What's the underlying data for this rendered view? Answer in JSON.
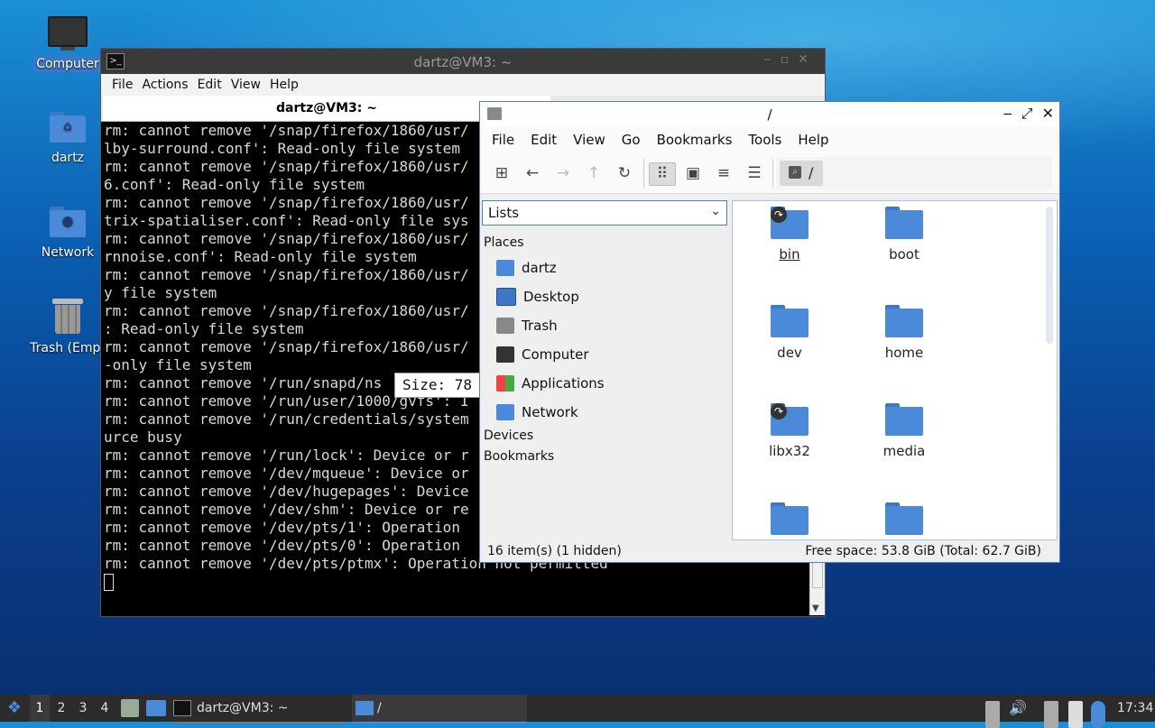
{
  "desktop": {
    "icons": [
      {
        "label": "Computer"
      },
      {
        "label": "dartz"
      },
      {
        "label": "Network"
      },
      {
        "label": "Trash (Empt"
      }
    ]
  },
  "terminal": {
    "title": "dartz@VM3: ~",
    "menu": [
      "File",
      "Actions",
      "Edit",
      "View",
      "Help"
    ],
    "tab_label": "dartz@VM3: ~",
    "lines": [
      "rm: cannot remove '/snap/firefox/1860/usr/",
      "lby-surround.conf': Read-only file system",
      "rm: cannot remove '/snap/firefox/1860/usr/",
      "6.conf': Read-only file system",
      "rm: cannot remove '/snap/firefox/1860/usr/",
      "trix-spatialiser.conf': Read-only file sys",
      "rm: cannot remove '/snap/firefox/1860/usr/",
      "rnnoise.conf': Read-only file system",
      "rm: cannot remove '/snap/firefox/1860/usr/",
      "y file system",
      "rm: cannot remove '/snap/firefox/1860/usr/",
      ": Read-only file system",
      "rm: cannot remove '/snap/firefox/1860/usr/",
      "-only file system",
      "rm: cannot remove '/run/snapd/ns",
      "rm: cannot remove '/run/user/1000/gvfs': I",
      "rm: cannot remove '/run/credentials/system",
      "urce busy",
      "rm: cannot remove '/run/lock': Device or r",
      "rm: cannot remove '/dev/mqueue': Device or",
      "rm: cannot remove '/dev/hugepages': Device",
      "rm: cannot remove '/dev/shm': Device or re",
      "rm: cannot remove '/dev/pts/1': Operation",
      "rm: cannot remove '/dev/pts/0': Operation",
      "rm: cannot remove '/dev/pts/ptmx': Operation not permitted"
    ],
    "tooltip": "Size: 78"
  },
  "filemanager": {
    "title": "/",
    "menu": [
      "File",
      "Edit",
      "View",
      "Go",
      "Bookmarks",
      "Tools",
      "Help"
    ],
    "path": "/",
    "side_mode": "Lists",
    "places_header": "Places",
    "places": [
      "dartz",
      "Desktop",
      "Trash",
      "Computer",
      "Applications",
      "Network"
    ],
    "devices_header": "Devices",
    "bookmarks_header": "Bookmarks",
    "files": [
      "bin",
      "boot",
      "dev",
      "home",
      "libx32",
      "media",
      "",
      ""
    ],
    "status_left": "16 item(s) (1 hidden)",
    "status_right": "Free space: 53.8 GiB (Total: 62.7 GiB)"
  },
  "taskbar": {
    "workspaces": [
      "1",
      "2",
      "3",
      "4"
    ],
    "tasks": [
      "dartz@VM3: ~",
      "/"
    ],
    "clock": "17:34"
  }
}
